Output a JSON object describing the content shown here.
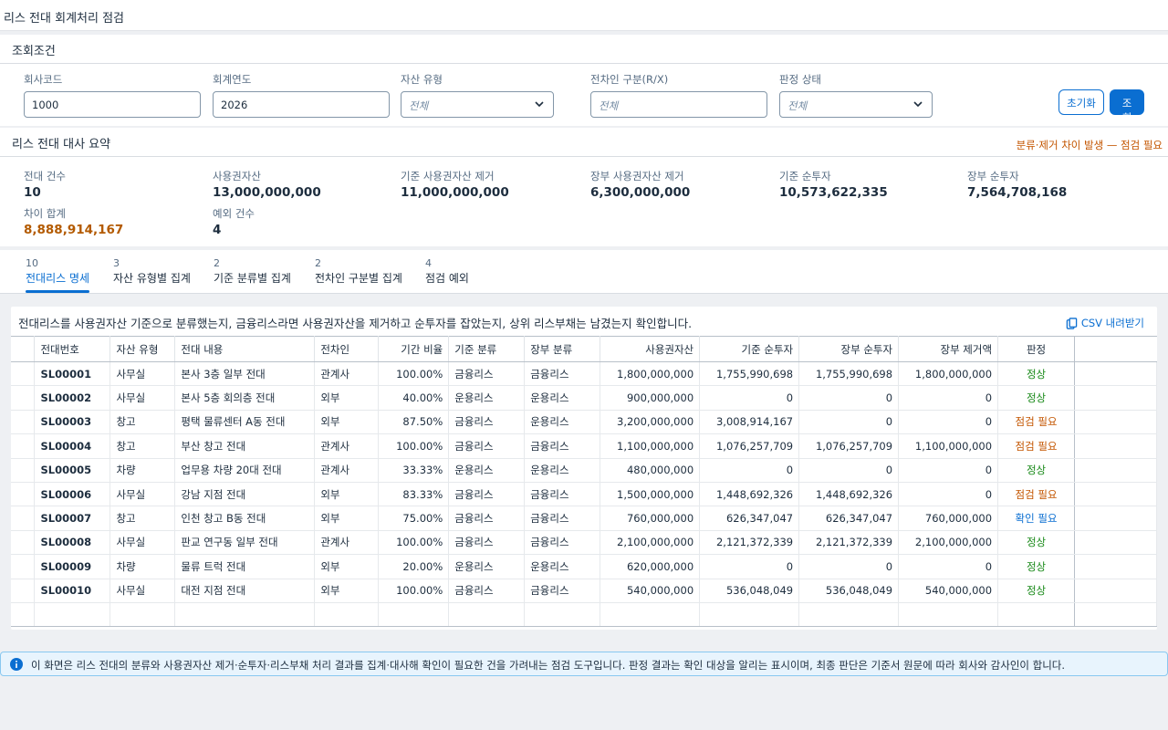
{
  "page": {
    "title": "리스 전대 회계처리 점검"
  },
  "filters": {
    "section_title": "조회조건",
    "company_code": {
      "label": "회사코드",
      "value": "1000"
    },
    "fiscal_year": {
      "label": "회계연도",
      "value": "2026"
    },
    "asset_type": {
      "label": "자산 유형",
      "value": "전체"
    },
    "lessee_type": {
      "label": "전차인 구분(R/X)",
      "placeholder": "전체"
    },
    "judgement_status": {
      "label": "판정 상태",
      "value": "전체"
    },
    "reset_label": "초기화",
    "search_label": "조회"
  },
  "summary": {
    "title": "리스 전대 대사 요약",
    "warning": "분류·제거 차이 발생 — 점검 필요",
    "kpis": [
      {
        "label": "전대 건수",
        "value": "10"
      },
      {
        "label": "사용권자산",
        "value": "13,000,000,000"
      },
      {
        "label": "기준 사용권자산 제거",
        "value": "11,000,000,000"
      },
      {
        "label": "장부 사용권자산 제거",
        "value": "6,300,000,000"
      },
      {
        "label": "기준 순투자",
        "value": "10,573,622,335"
      },
      {
        "label": "장부 순투자",
        "value": "7,564,708,168"
      },
      {
        "label": "차이 합계",
        "value": "8,888,914,167"
      },
      {
        "label": "예외 건수",
        "value": "4"
      }
    ]
  },
  "tabs": [
    {
      "count": "10",
      "label": "전대리스 명세"
    },
    {
      "count": "3",
      "label": "자산 유형별 집계"
    },
    {
      "count": "2",
      "label": "기준 분류별 집계"
    },
    {
      "count": "2",
      "label": "전차인 구분별 집계"
    },
    {
      "count": "4",
      "label": "점검 예외"
    }
  ],
  "table": {
    "description": "전대리스를 사용권자산 기준으로 분류했는지, 금융리스라면 사용권자산을 제거하고 순투자를 잡았는지, 상위 리스부채는 남겼는지 확인합니다.",
    "csv_label": "CSV 내려받기",
    "columns": [
      "전대번호",
      "자산 유형",
      "전대 내용",
      "전차인",
      "기간 비율",
      "기준 분류",
      "장부 분류",
      "사용권자산",
      "기준 순투자",
      "장부 순투자",
      "장부 제거액",
      "판정"
    ],
    "rows": [
      [
        "SL00001",
        "사무실",
        "본사 3층 일부 전대",
        "관계사",
        "100.00%",
        "금융리스",
        "금융리스",
        "1,800,000,000",
        "1,755,990,698",
        "1,755,990,698",
        "1,800,000,000",
        "정상"
      ],
      [
        "SL00002",
        "사무실",
        "본사 5층 회의층 전대",
        "외부",
        "40.00%",
        "운용리스",
        "운용리스",
        "900,000,000",
        "0",
        "0",
        "0",
        "정상"
      ],
      [
        "SL00003",
        "창고",
        "평택 물류센터 A동 전대",
        "외부",
        "87.50%",
        "금융리스",
        "운용리스",
        "3,200,000,000",
        "3,008,914,167",
        "0",
        "0",
        "점검 필요"
      ],
      [
        "SL00004",
        "창고",
        "부산 창고 전대",
        "관계사",
        "100.00%",
        "금융리스",
        "금융리스",
        "1,100,000,000",
        "1,076,257,709",
        "1,076,257,709",
        "1,100,000,000",
        "점검 필요"
      ],
      [
        "SL00005",
        "차량",
        "업무용 차량 20대 전대",
        "관계사",
        "33.33%",
        "운용리스",
        "운용리스",
        "480,000,000",
        "0",
        "0",
        "0",
        "정상"
      ],
      [
        "SL00006",
        "사무실",
        "강남 지점 전대",
        "외부",
        "83.33%",
        "금융리스",
        "금융리스",
        "1,500,000,000",
        "1,448,692,326",
        "1,448,692,326",
        "0",
        "점검 필요"
      ],
      [
        "SL00007",
        "창고",
        "인천 창고 B동 전대",
        "외부",
        "75.00%",
        "금융리스",
        "금융리스",
        "760,000,000",
        "626,347,047",
        "626,347,047",
        "760,000,000",
        "확인 필요"
      ],
      [
        "SL00008",
        "사무실",
        "판교 연구동 일부 전대",
        "관계사",
        "100.00%",
        "금융리스",
        "금융리스",
        "2,100,000,000",
        "2,121,372,339",
        "2,121,372,339",
        "2,100,000,000",
        "정상"
      ],
      [
        "SL00009",
        "차량",
        "물류 트럭 전대",
        "외부",
        "20.00%",
        "운용리스",
        "운용리스",
        "620,000,000",
        "0",
        "0",
        "0",
        "정상"
      ],
      [
        "SL00010",
        "사무실",
        "대전 지점 전대",
        "외부",
        "100.00%",
        "금융리스",
        "금융리스",
        "540,000,000",
        "536,048,049",
        "536,048,049",
        "540,000,000",
        "정상"
      ]
    ]
  },
  "info": {
    "text": "이 화면은 리스 전대의 분류와 사용권자산 제거·순투자·리스부채 처리 결과를 집계·대사해 확인이 필요한 건을 가려내는 점검 도구입니다. 판정 결과는 확인 대상을 알리는 표시이며, 최종 판단은 기준서 원문에 따라 회사와 감사인이 합니다."
  },
  "colors": {
    "accent": "#0a6ed1",
    "ok": "#188918",
    "warn": "#c35500"
  }
}
